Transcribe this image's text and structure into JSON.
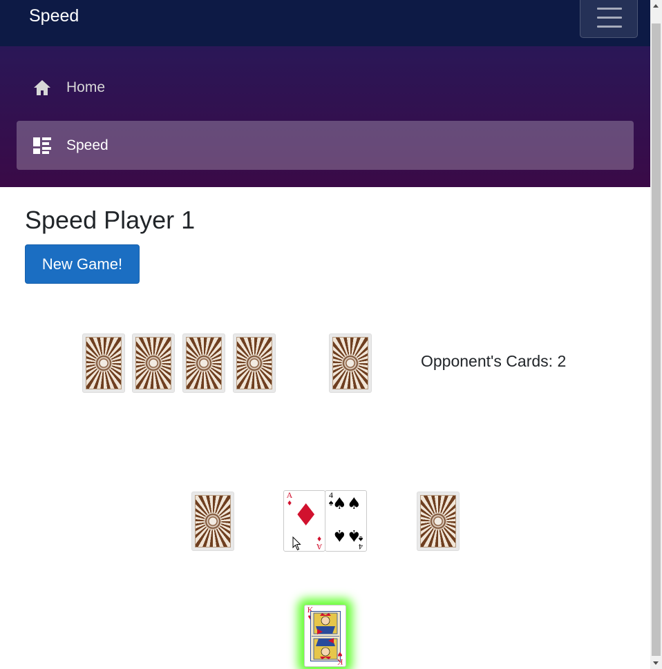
{
  "app": {
    "brand": "Speed"
  },
  "nav": {
    "items": [
      {
        "label": "Home",
        "icon": "home-icon",
        "active": false
      },
      {
        "label": "Speed",
        "icon": "list-icon",
        "active": true
      }
    ]
  },
  "main": {
    "title": "Speed Player 1",
    "new_game_label": "New Game!",
    "opponent_cards_text": "Opponent's Cards: 2"
  },
  "cards": {
    "opponent_hand": [
      "face-down",
      "face-down",
      "face-down",
      "face-down"
    ],
    "opponent_draw_pile": "face-down",
    "left_side_pile": "face-down",
    "center_pile_1": {
      "rank": "A",
      "suit": "♦",
      "color": "#d1112e"
    },
    "center_pile_2": {
      "rank": "4",
      "suit": "♠",
      "color": "#000000"
    },
    "right_side_pile": "face-down",
    "player_card": {
      "rank": "K",
      "suit": "♥",
      "color": "#d1112e",
      "highlighted": true
    }
  },
  "colors": {
    "top_bar": "#0d1a45",
    "nav_gradient_top": "#2a1757",
    "nav_gradient_bottom": "#3a0a47",
    "button": "#1b6ec2",
    "highlight_glow": "#66ff33"
  }
}
